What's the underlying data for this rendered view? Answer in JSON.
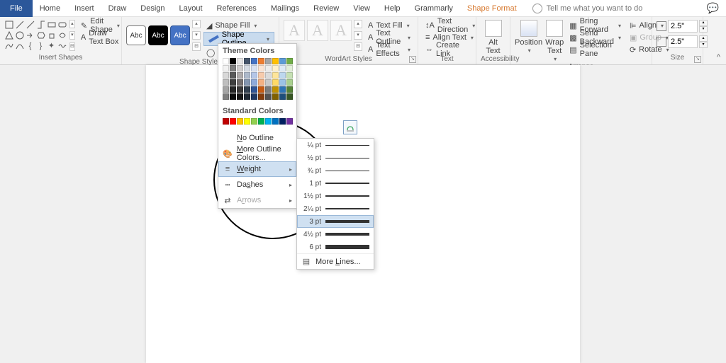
{
  "tabs": {
    "file": "File",
    "home": "Home",
    "insert": "Insert",
    "draw": "Draw",
    "design": "Design",
    "layout": "Layout",
    "references": "References",
    "mailings": "Mailings",
    "review": "Review",
    "view": "View",
    "help": "Help",
    "grammarly": "Grammarly",
    "shape_format": "Shape Format"
  },
  "tellme": "Tell me what you want to do",
  "groups": {
    "insert_shapes": "Insert Shapes",
    "shape_styles": "Shape Styles",
    "wordart_styles": "WordArt Styles",
    "text": "Text",
    "accessibility": "Accessibility",
    "arrange": "Arrange",
    "size": "Size"
  },
  "shapes_panel": {
    "edit_shape": "Edit Shape",
    "draw_text_box": "Draw Text Box"
  },
  "shape_styles": {
    "thumb_label": "Abc",
    "shape_fill": "Shape Fill",
    "shape_outline": "Shape Outline",
    "shape_effects": "Shape Effects"
  },
  "wordart": {
    "a": "A"
  },
  "text_panel": {
    "text_fill": "Text Fill",
    "text_outline": "Text Outline",
    "text_effects": "Text Effects",
    "text_direction": "Text Direction",
    "align_text": "Align Text",
    "create_link": "Create Link"
  },
  "accessibility": {
    "alt_text": "Alt\nText"
  },
  "arrange": {
    "position": "Position",
    "wrap_text": "Wrap\nText",
    "bring_forward": "Bring Forward",
    "send_backward": "Send Backward",
    "selection_pane": "Selection Pane",
    "align": "Align",
    "group": "Group",
    "rotate": "Rotate"
  },
  "size": {
    "height": "2.5\"",
    "width": "2.5\""
  },
  "outline_menu": {
    "theme_colors": "Theme Colors",
    "standard_colors": "Standard Colors",
    "no_outline": "No Outline",
    "more_colors": "More Outline Colors...",
    "weight": "Weight",
    "dashes": "Dashes",
    "arrows": "Arrows",
    "theme_palette": [
      [
        "#ffffff",
        "#000000",
        "#e7e6e6",
        "#44546a",
        "#4472c4",
        "#ed7d31",
        "#a5a5a5",
        "#ffc000",
        "#5b9bd5",
        "#70ad47"
      ],
      [
        "#f2f2f2",
        "#7f7f7f",
        "#d0cece",
        "#d6dce4",
        "#d9e2f3",
        "#fbe5d5",
        "#ededed",
        "#fff2cc",
        "#deebf6",
        "#e2efd9"
      ],
      [
        "#d8d8d8",
        "#595959",
        "#aeabab",
        "#adb9ca",
        "#b4c6e7",
        "#f7cbac",
        "#dbdbdb",
        "#fee599",
        "#bdd7ee",
        "#c5e0b3"
      ],
      [
        "#bfbfbf",
        "#3f3f3f",
        "#757070",
        "#8496b0",
        "#8eaadb",
        "#f4b183",
        "#c9c9c9",
        "#ffd965",
        "#9cc3e5",
        "#a8d08d"
      ],
      [
        "#a5a5a5",
        "#262626",
        "#3a3838",
        "#323f4f",
        "#2f5496",
        "#c55a11",
        "#7b7b7b",
        "#bf9000",
        "#2e75b5",
        "#538135"
      ],
      [
        "#7f7f7f",
        "#0c0c0c",
        "#171616",
        "#222a35",
        "#1f3864",
        "#833c0b",
        "#525252",
        "#7f6000",
        "#1e4e79",
        "#375623"
      ]
    ],
    "standard_palette": [
      "#c00000",
      "#ff0000",
      "#ffc000",
      "#ffff00",
      "#92d050",
      "#00b050",
      "#00b0f0",
      "#0070c0",
      "#002060",
      "#7030a0"
    ]
  },
  "weight_menu": {
    "items": [
      {
        "label": "¼ pt",
        "px": 0.5
      },
      {
        "label": "½ pt",
        "px": 0.75
      },
      {
        "label": "¾ pt",
        "px": 1
      },
      {
        "label": "1 pt",
        "px": 1.3
      },
      {
        "label": "1½ pt",
        "px": 1.8
      },
      {
        "label": "2¼ pt",
        "px": 2.5
      },
      {
        "label": "3 pt",
        "px": 3.2
      },
      {
        "label": "4½ pt",
        "px": 4.5
      },
      {
        "label": "6 pt",
        "px": 6
      }
    ],
    "selected": "3 pt",
    "more_lines": "More Lines..."
  }
}
